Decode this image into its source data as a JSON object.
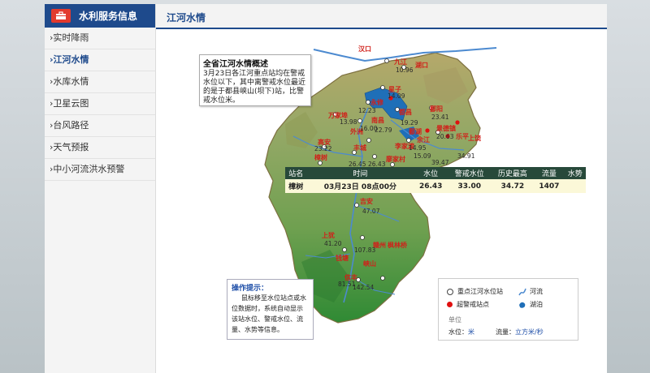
{
  "sidebar": {
    "title": "水利服务信息",
    "items": [
      {
        "label": "›实时降雨"
      },
      {
        "label": "›江河水情"
      },
      {
        "label": "›水库水情"
      },
      {
        "label": "›卫星云图"
      },
      {
        "label": "›台风路径"
      },
      {
        "label": "›天气预报"
      },
      {
        "label": "›中小河流洪水预警"
      }
    ],
    "active_index": 1
  },
  "header": {
    "title": "江河水情"
  },
  "overview": {
    "title": "全省江河水情概述",
    "text": "3月23日各江河重点站均在警戒水位以下，其中离警戒水位最近的是于都县峡山(坝下)站，比警戒水位米。"
  },
  "tip": {
    "title": "操作提示：",
    "text": "鼠标移至水位站点或水位数据时，系统自动显示该站水位、警戒水位、流量、水势等信息。"
  },
  "legend": {
    "key_station": "重点江河水位站",
    "warning_station": "超警戒站点",
    "river": "河流",
    "lake": "湖泊",
    "unit_title": "单位",
    "water_level_label": "水位：",
    "water_level_unit": "米",
    "flow_label": "流量：",
    "flow_unit": "立方米/秒"
  },
  "station_table": {
    "headers": [
      "站名",
      "时间",
      "水位",
      "警戒水位",
      "历史最高",
      "流量",
      "水势"
    ],
    "rows": [
      [
        "樟树",
        "03月23日 08点00分",
        "26.43",
        "33.00",
        "34.72",
        "1407",
        ""
      ]
    ]
  },
  "map_labels": {
    "places": [
      "汉口",
      "九江",
      "湖口",
      "星子",
      "都昌",
      "永修",
      "鄱阳",
      "万家埠",
      "南昌",
      "景德镇",
      "乐平",
      "外洲",
      "高安",
      "李家渡",
      "丰城",
      "余江",
      "上饶",
      "樟树",
      "廖家村",
      "吉安",
      "峡江",
      "赣州",
      "峡山",
      "信丰",
      "枫林桥",
      "钱塘",
      "上犹",
      "鄱湖"
    ],
    "values": [
      "10.96",
      "14.09",
      "12.23",
      "23.41",
      "13.98",
      "16.00",
      "19.29",
      "22.79",
      "20.63",
      "39.47",
      "34.91",
      "23.22",
      "26.45",
      "26.43",
      "47.07",
      "41.20",
      "107.83",
      "81.51",
      "142.54",
      "14.95",
      "15.09"
    ]
  },
  "colors": {
    "brand": "#1e4a8c",
    "warning": "#e01010",
    "table_header": "#27493a",
    "table_row": "#fbf8d8"
  }
}
